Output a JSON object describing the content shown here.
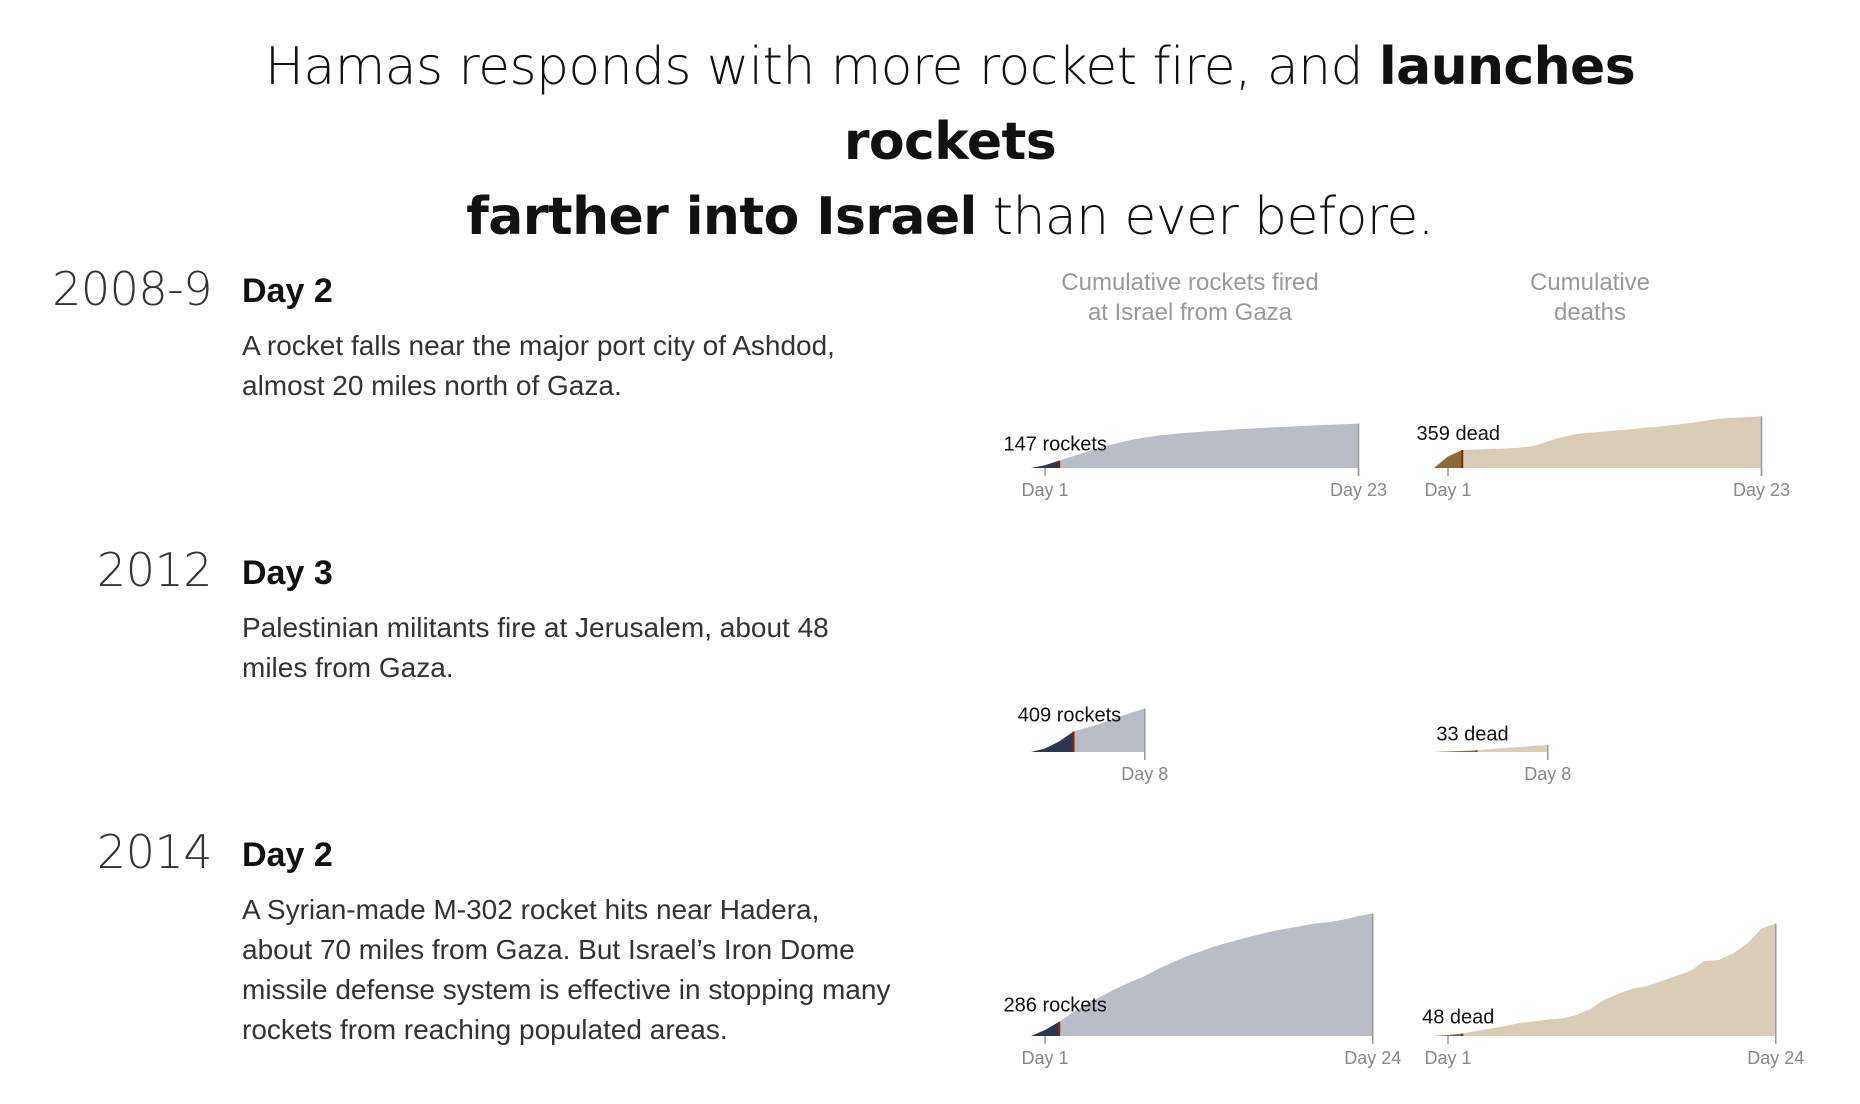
{
  "headline": {
    "part1": "Hamas responds with more rocket fire, and ",
    "bold1": "launches rockets",
    "bold2": "farther into Israel",
    "part2": " than ever before."
  },
  "column_titles": {
    "rockets": [
      "Cumulative rockets fired",
      "at Israel from Gaza"
    ],
    "deaths": [
      "Cumulative",
      "deaths"
    ]
  },
  "colors": {
    "rockets_fill": "#b9bdc6",
    "rockets_highlight": "#2a3653",
    "deaths_fill": "#dacdb8",
    "deaths_highlight": "#8a6a34",
    "marker": "#8b2500",
    "axis": "#999999"
  },
  "conflicts": [
    {
      "year": "2008-9",
      "day_label": "Day 2",
      "description": [
        "A rocket falls near the major port city of Ashdod,",
        "almost 20 miles north of Gaza."
      ]
    },
    {
      "year": "2012",
      "day_label": "Day 3",
      "description": [
        "Palestinian militants fire at Jerusalem, about 48",
        "miles from Gaza."
      ]
    },
    {
      "year": "2014",
      "day_label": "Day 2",
      "description": [
        "A Syrian-made M-302 rocket hits near Hadera,",
        "about 70 miles from Gaza. But Israel’s Iron Dome",
        "missile defense system is effective in stopping many",
        "rockets from reaching populated areas."
      ]
    }
  ],
  "chart_data": [
    {
      "type": "area",
      "conflict": "2008-9",
      "metric": "Cumulative rockets fired at Israel from Gaza",
      "x": [
        1,
        2,
        3,
        4,
        5,
        6,
        7,
        8,
        9,
        10,
        11,
        12,
        13,
        14,
        15,
        16,
        17,
        18,
        19,
        20,
        21,
        22,
        23
      ],
      "y": [
        55,
        147,
        240,
        330,
        420,
        490,
        560,
        610,
        650,
        680,
        705,
        725,
        745,
        765,
        782,
        798,
        812,
        826,
        840,
        852,
        864,
        876,
        890
      ],
      "highlight_day": 2,
      "annotation": "147 rockets",
      "x_tick_labels": [
        "Day 1",
        "Day 23"
      ],
      "ylim": [
        0,
        2400
      ]
    },
    {
      "type": "area",
      "conflict": "2008-9",
      "metric": "Cumulative deaths",
      "x": [
        1,
        2,
        3,
        4,
        5,
        6,
        7,
        8,
        9,
        10,
        11,
        12,
        13,
        14,
        15,
        16,
        17,
        18,
        19,
        20,
        21,
        22,
        23
      ],
      "y": [
        230,
        359,
        370,
        380,
        390,
        405,
        440,
        530,
        620,
        680,
        705,
        730,
        755,
        780,
        810,
        835,
        865,
        900,
        945,
        985,
        1005,
        1015,
        1035
      ],
      "highlight_day": 2,
      "annotation": "359 dead",
      "x_tick_labels": [
        "Day 1",
        "Day 23"
      ],
      "ylim": [
        0,
        2400
      ]
    },
    {
      "type": "area",
      "conflict": "2012",
      "metric": "Cumulative rockets fired at Israel from Gaza",
      "x": [
        1,
        2,
        3,
        4,
        5,
        6,
        7,
        8
      ],
      "y": [
        70,
        210,
        409,
        490,
        580,
        680,
        780,
        870
      ],
      "highlight_day": 3,
      "annotation": "409 rockets",
      "x_tick_labels": [
        "Day 8"
      ],
      "ylim": [
        0,
        2400
      ]
    },
    {
      "type": "area",
      "conflict": "2012",
      "metric": "Cumulative deaths",
      "x": [
        1,
        2,
        3,
        4,
        5,
        6,
        7,
        8
      ],
      "y": [
        10,
        20,
        33,
        60,
        80,
        100,
        120,
        140
      ],
      "highlight_day": 3,
      "annotation": "33 dead",
      "x_tick_labels": [
        "Day 8"
      ],
      "ylim": [
        0,
        2400
      ]
    },
    {
      "type": "area",
      "conflict": "2014",
      "metric": "Cumulative rockets fired at Israel from Gaza",
      "x": [
        1,
        2,
        3,
        4,
        5,
        6,
        7,
        8,
        9,
        10,
        11,
        12,
        13,
        14,
        15,
        16,
        17,
        18,
        19,
        20,
        21,
        22,
        23,
        24
      ],
      "y": [
        120,
        286,
        480,
        650,
        800,
        950,
        1080,
        1200,
        1350,
        1480,
        1600,
        1700,
        1800,
        1880,
        1960,
        2030,
        2100,
        2150,
        2200,
        2250,
        2280,
        2330,
        2400,
        2450
      ],
      "highlight_day": 2,
      "annotation": "286 rockets",
      "x_tick_labels": [
        "Day 1",
        "Day 24"
      ],
      "ylim": [
        0,
        2400
      ]
    },
    {
      "type": "area",
      "conflict": "2014",
      "metric": "Cumulative deaths",
      "x": [
        1,
        2,
        3,
        4,
        5,
        6,
        7,
        8,
        9,
        10,
        11,
        12,
        13,
        14,
        15,
        16,
        17,
        18,
        19,
        20,
        21,
        22,
        23,
        24
      ],
      "y": [
        20,
        48,
        100,
        150,
        200,
        260,
        290,
        330,
        350,
        420,
        540,
        730,
        850,
        950,
        1000,
        1100,
        1200,
        1300,
        1500,
        1520,
        1650,
        1850,
        2150,
        2250
      ],
      "highlight_day": 2,
      "annotation": "48 dead",
      "x_tick_labels": [
        "Day 1",
        "Day 24"
      ],
      "ylim": [
        0,
        2400
      ]
    }
  ]
}
